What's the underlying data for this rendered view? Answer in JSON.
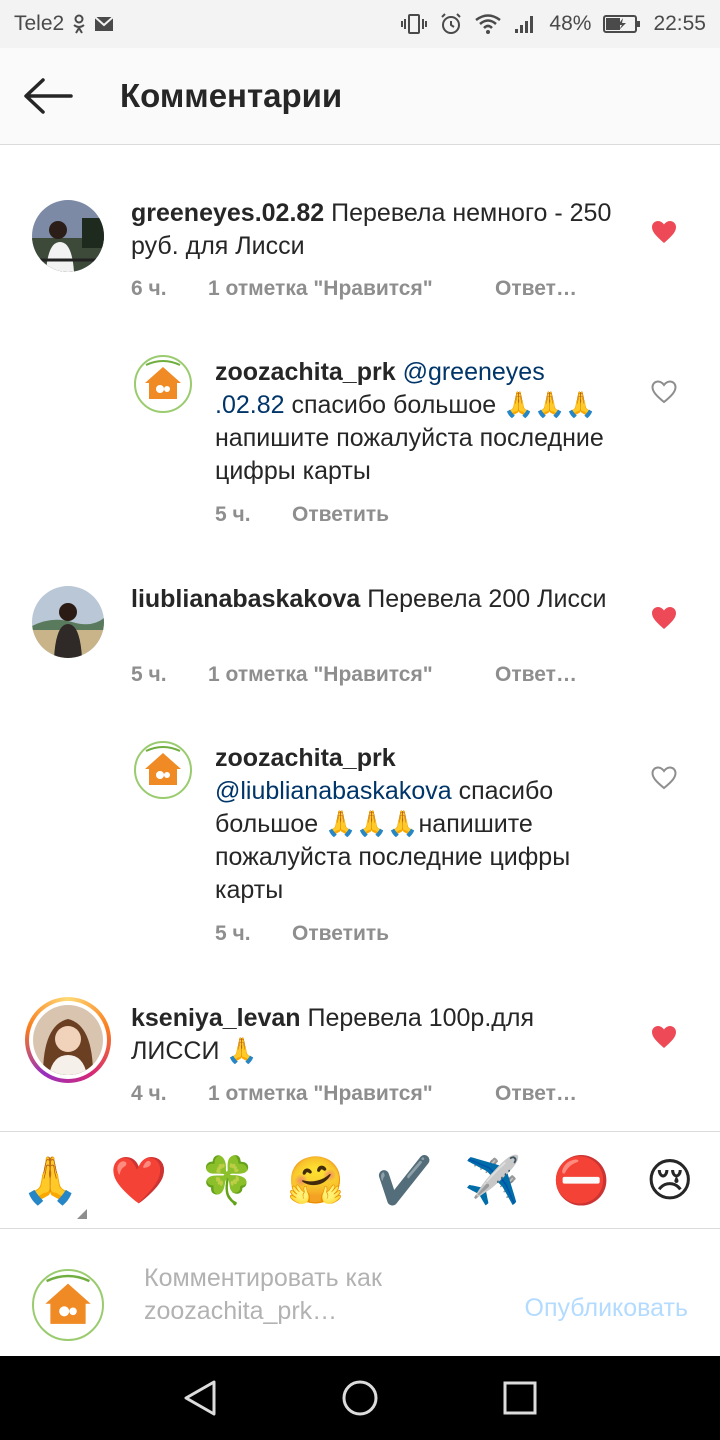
{
  "status_bar": {
    "carrier": "Tele2",
    "battery": "48%",
    "time": "22:55"
  },
  "header": {
    "title": "Комментарии"
  },
  "comments": [
    {
      "username": "greeneyes.02.82",
      "text": " Перевела немного - 250 руб. для Лисси",
      "time": "6 ч.",
      "likes": "1 отметка \"Нравится\"",
      "reply": "Ответ…",
      "liked": true
    },
    {
      "username": "zoozachita_prk",
      "mention": "@greeneyes .02.82",
      "text": " спасибо большое 🙏🙏🙏напишите пожалуйста последние цифры карты",
      "time": "5 ч.",
      "reply": "Ответить",
      "liked": false
    },
    {
      "username": "liublianabaskakova",
      "text": " Перевела 200 Лисси",
      "time": "5 ч.",
      "likes": "1 отметка \"Нравится\"",
      "reply": "Ответ…",
      "liked": true
    },
    {
      "username": "zoozachita_prk",
      "mention": "@liublianabaskakova",
      "text": " спасибо большое 🙏🙏🙏напишите пожалуйста последние цифры карты",
      "time": "5 ч.",
      "reply": "Ответить",
      "liked": false
    },
    {
      "username": "kseniya_levan",
      "text": " Перевела 100р.для ЛИССИ 🙏",
      "time": "4 ч.",
      "likes": "1 отметка \"Нравится\"",
      "reply": "Ответ…",
      "liked": true
    }
  ],
  "emoji_bar": [
    "🙏",
    "❤️",
    "🍀",
    "🤗",
    "✔️",
    "✈️",
    "⛔",
    "😢"
  ],
  "input": {
    "placeholder": "Комментировать как zoozachita_prk…",
    "publish": "Опубликовать"
  },
  "colors": {
    "heart_red": "#ed4956",
    "mention_blue": "#003569",
    "meta_gray": "#8e8e8e",
    "publish_disabled": "#b3dbff"
  }
}
